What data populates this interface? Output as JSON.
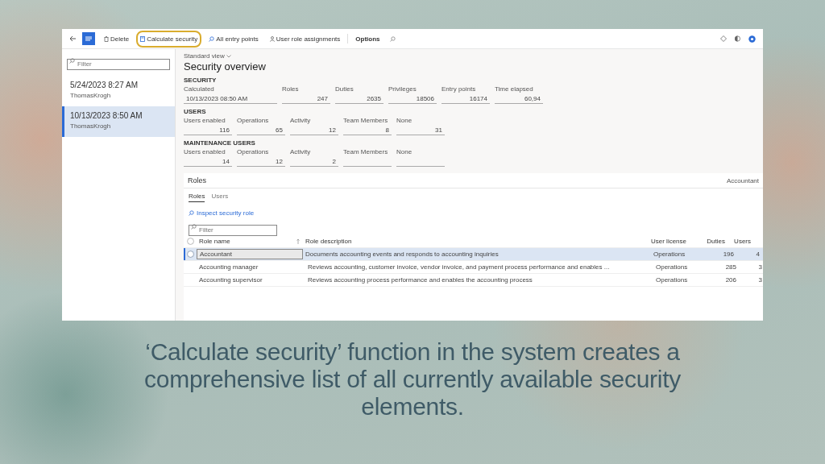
{
  "toolbar": {
    "buttons": [
      {
        "label": "Delete",
        "kind": "trash",
        "highlighted": false
      },
      {
        "label": "Calculate security",
        "kind": "calc",
        "highlighted": true
      },
      {
        "label": "All entry points",
        "kind": "search",
        "highlighted": false
      },
      {
        "label": "User role assignments",
        "kind": "person",
        "highlighted": false
      },
      {
        "label": "Options",
        "kind": "plain",
        "highlighted": false
      }
    ]
  },
  "list": {
    "filter_placeholder": "Filter",
    "items": [
      {
        "date": "5/24/2023 8:27 AM",
        "user": "ThomasKrogh",
        "selected": false
      },
      {
        "date": "10/13/2023 8:50 AM",
        "user": "ThomasKrogh",
        "selected": true
      }
    ]
  },
  "main": {
    "view": "Standard view",
    "title": "Security overview",
    "sections": [
      {
        "heading": "SECURITY",
        "fields": [
          {
            "label": "Calculated",
            "value": "10/13/2023 08:50 AM",
            "kind": "date"
          },
          {
            "label": "Roles",
            "value": "247",
            "kind": "number"
          },
          {
            "label": "Duties",
            "value": "2635",
            "kind": "number"
          },
          {
            "label": "Privileges",
            "value": "18506",
            "kind": "number"
          },
          {
            "label": "Entry points",
            "value": "16174",
            "kind": "number"
          },
          {
            "label": "Time elapsed",
            "value": "60,94",
            "kind": "number"
          }
        ]
      },
      {
        "heading": "USERS",
        "fields": [
          {
            "label": "Users enabled",
            "value": "116",
            "kind": "number"
          },
          {
            "label": "Operations",
            "value": "65",
            "kind": "number"
          },
          {
            "label": "Activity",
            "value": "12",
            "kind": "number"
          },
          {
            "label": "Team Members",
            "value": "8",
            "kind": "number"
          },
          {
            "label": "None",
            "value": "31",
            "kind": "number"
          }
        ]
      },
      {
        "heading": "MAINTENANCE USERS",
        "fields": [
          {
            "label": "Users enabled",
            "value": "14",
            "kind": "number"
          },
          {
            "label": "Operations",
            "value": "12",
            "kind": "number"
          },
          {
            "label": "Activity",
            "value": "2",
            "kind": "number"
          },
          {
            "label": "Team Members",
            "kind": "number"
          },
          {
            "label": "None",
            "kind": "number"
          }
        ]
      }
    ]
  },
  "roles": {
    "title": "Roles",
    "context": "Accountant",
    "tabs": [
      {
        "label": "Roles",
        "selected": true
      },
      {
        "label": "Users",
        "selected": false
      }
    ],
    "action": "Inspect security role",
    "filter_placeholder": "Filter",
    "table": {
      "select_all": {
        "checked": false
      },
      "columns": [
        "Role name",
        "Role description",
        "User license",
        "Duties",
        "Users"
      ],
      "rows": [
        {
          "cells": [
            "Accountant",
            "Documents accounting events and responds to accounting inquiries",
            "Operations",
            "196",
            "4"
          ],
          "selected": true
        },
        {
          "cells": [
            "Accounting manager",
            "Reviews accounting, customer invoice, vendor invoice, and payment process performance and enables ...",
            "Operations",
            "285",
            "3"
          ],
          "selected": false
        },
        {
          "cells": [
            "Accounting supervisor",
            "Reviews accounting process performance and enables the accounting process",
            "Operations",
            "206",
            "3"
          ],
          "selected": false
        }
      ]
    }
  },
  "caption": "‘Calculate security’ function in the system creates a comprehensive list of all currently available security elements."
}
